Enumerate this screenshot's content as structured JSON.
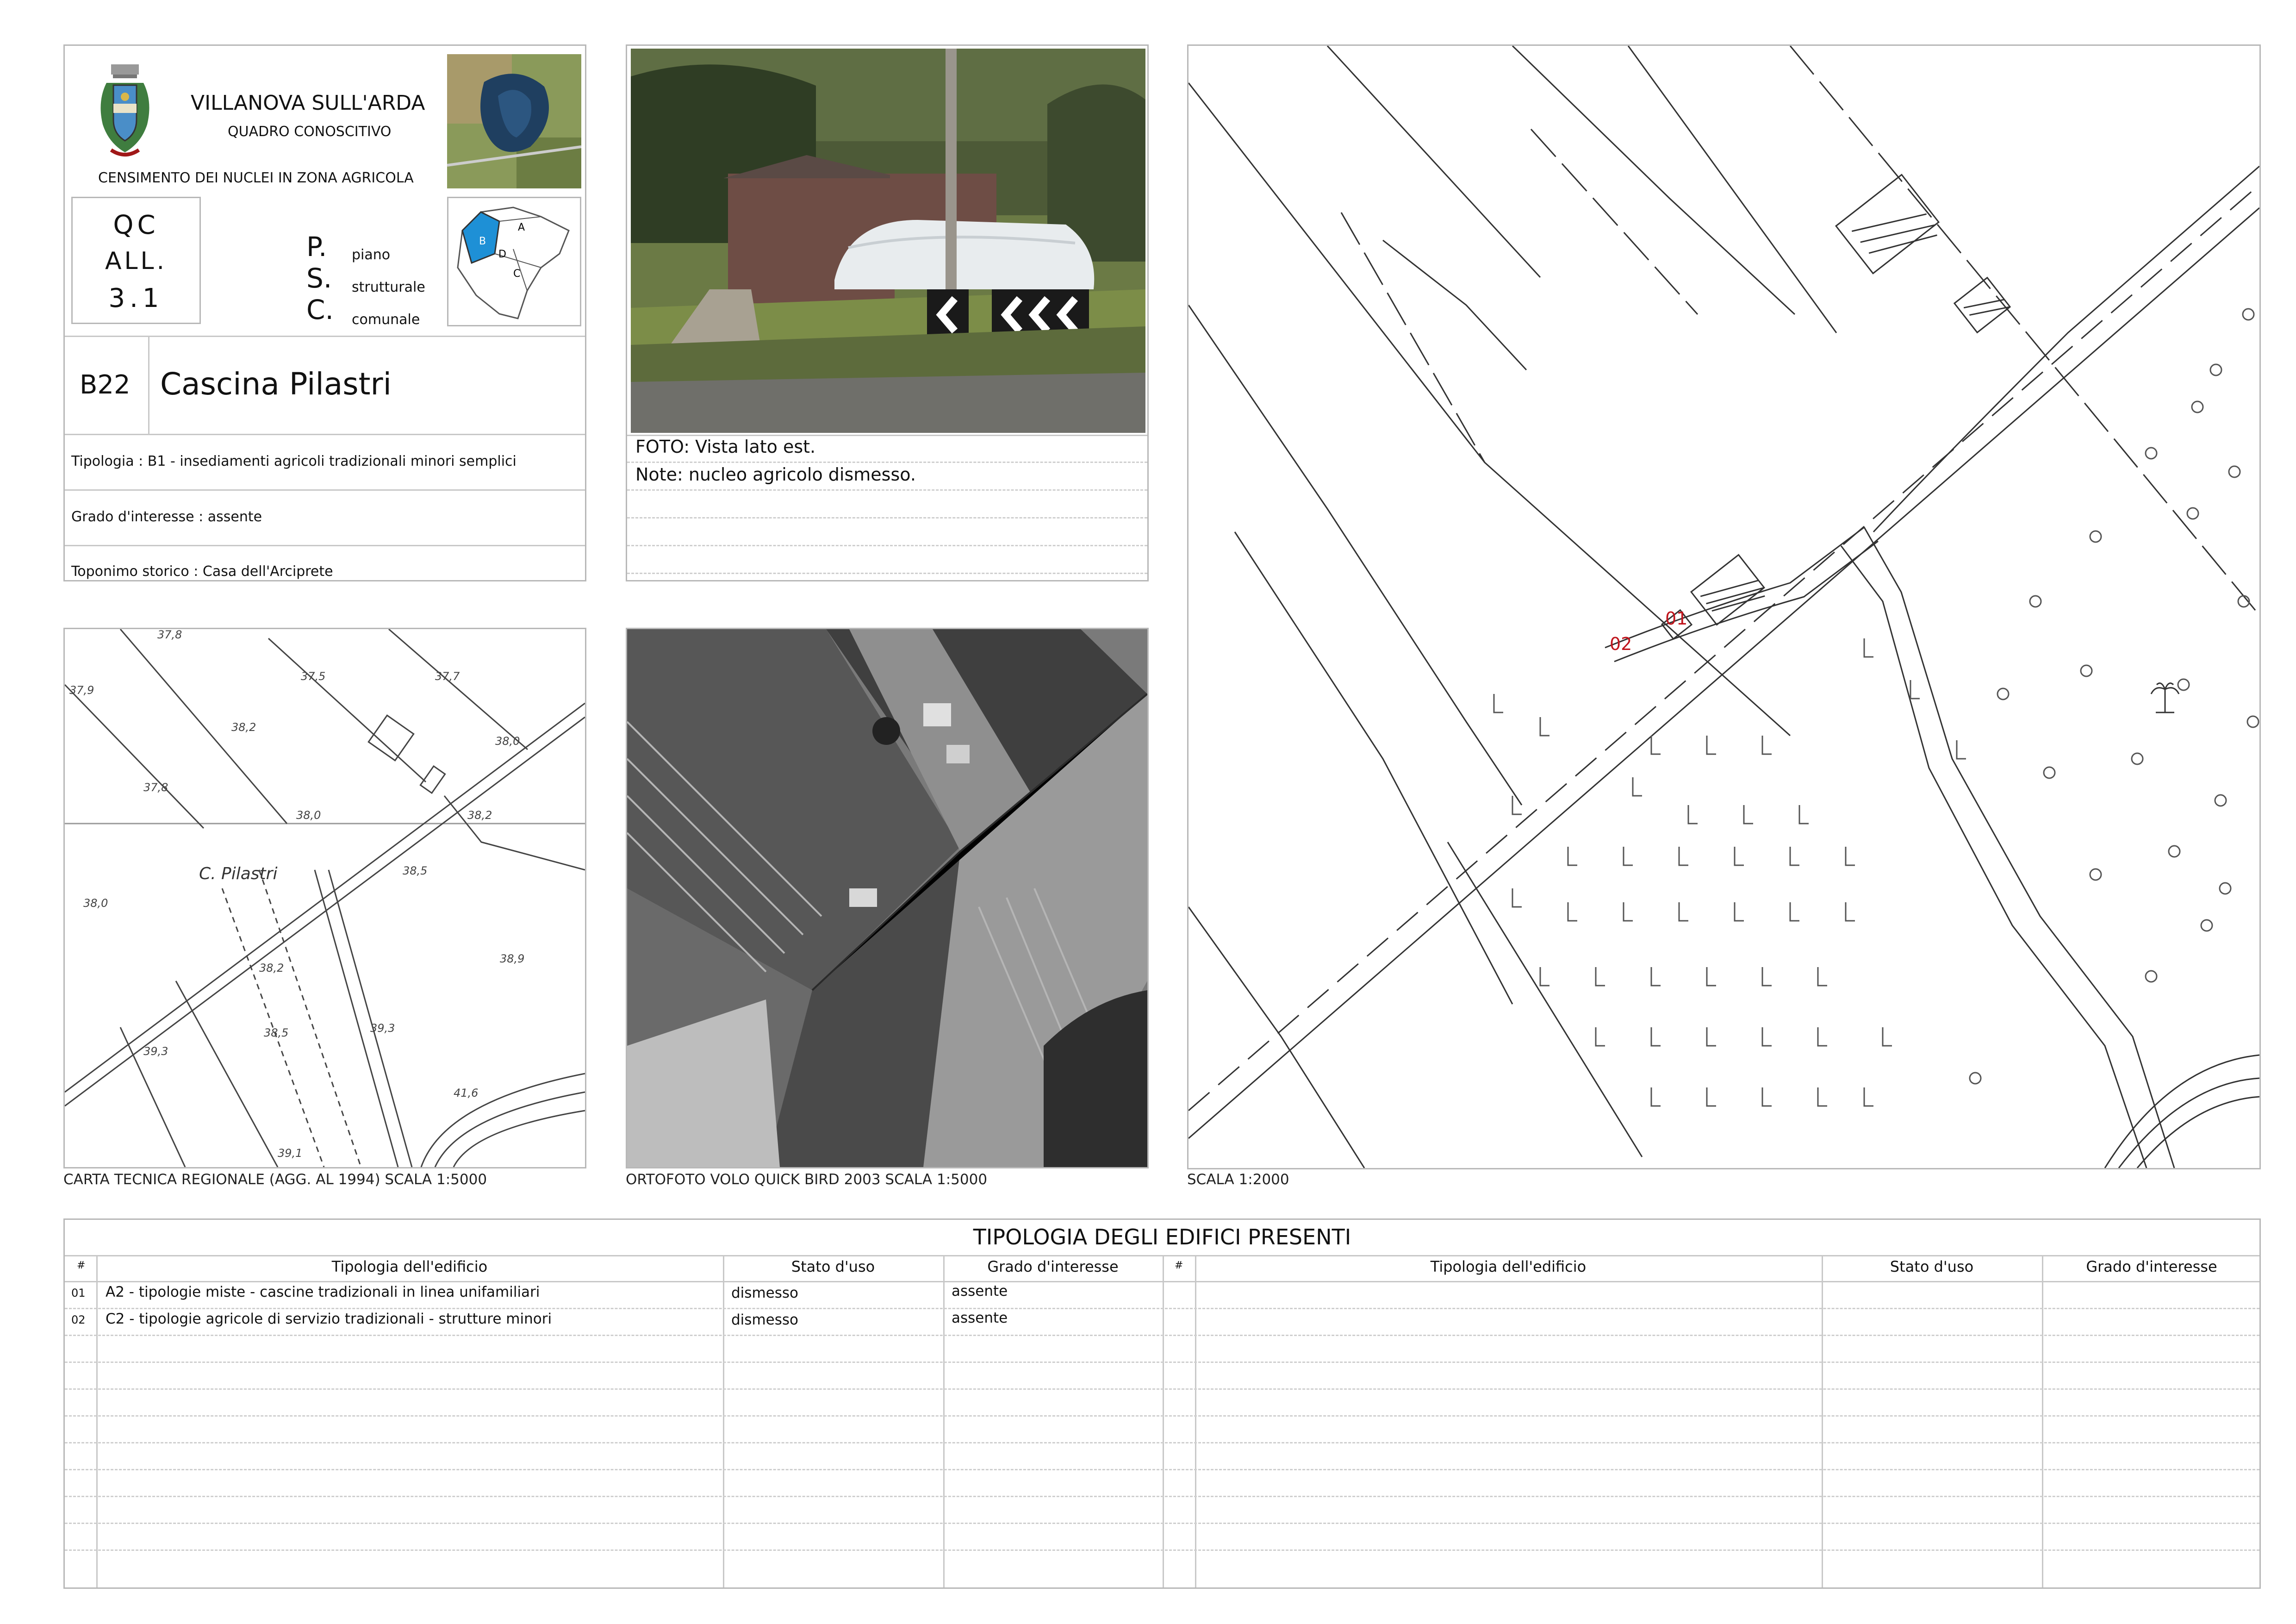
{
  "header": {
    "municipality": "VILLANOVA SULL'ARDA",
    "subtitle": "QUADRO CONOSCITIVO",
    "census": "CENSIMENTO DEI NUCLEI IN ZONA AGRICOLA",
    "qc": [
      "QC",
      "ALL.",
      "3.1"
    ],
    "psc_letters": [
      "P.",
      "S.",
      "C."
    ],
    "psc_words": [
      "piano",
      "strutturale",
      "comunale"
    ],
    "inset_labels": [
      "A",
      "B",
      "C",
      "D"
    ]
  },
  "record": {
    "code": "B22",
    "name": "Cascina Pilastri",
    "tipologia": "Tipologia : B1 - insediamenti agricoli tradizionali minori semplici",
    "grado": "Grado d'interesse : assente",
    "toponimo": "Toponimo storico : Casa dell'Arciprete"
  },
  "photo": {
    "caption": "FOTO: Vista lato est.",
    "note": "Note: nucleo agricolo dismesso."
  },
  "maps": {
    "ctr_caption": "CARTA TECNICA REGIONALE (AGG. AL 1994) SCALA 1:5000",
    "ortho_caption": "ORTOFOTO VOLO QUICK BIRD 2003 SCALA 1:5000",
    "plan_caption": "SCALA 1:2000",
    "ctr_place": "C. Pilastri",
    "ctr_elevations": [
      "37,8",
      "37,5",
      "37,7",
      "37,9",
      "38,2",
      "38,0",
      "37,8",
      "38,0",
      "38,2",
      "38,5",
      "38,0",
      "38,2",
      "38,5",
      "38,9",
      "39,3",
      "39,3",
      "39,1",
      "41,6"
    ],
    "plan_markers": [
      "01",
      "02"
    ]
  },
  "table": {
    "title": "TIPOLOGIA DEGLI EDIFICI PRESENTI",
    "headers": [
      "#",
      "Tipologia dell'edificio",
      "Stato d'uso",
      "Grado d'interesse"
    ],
    "rows": [
      {
        "n": "01",
        "tipologia": "A2 - tipologie miste - cascine tradizionali in linea unifamiliari",
        "stato": "dismesso",
        "grado": "assente"
      },
      {
        "n": "02",
        "tipologia": "C2 - tipologie agricole di servizio tradizionali - strutture minori",
        "stato": "dismesso",
        "grado": "assente"
      }
    ]
  },
  "colors": {
    "accent_blue": "#1e90d6",
    "marker_red": "#c0141c",
    "border": "#b8b8b8"
  }
}
